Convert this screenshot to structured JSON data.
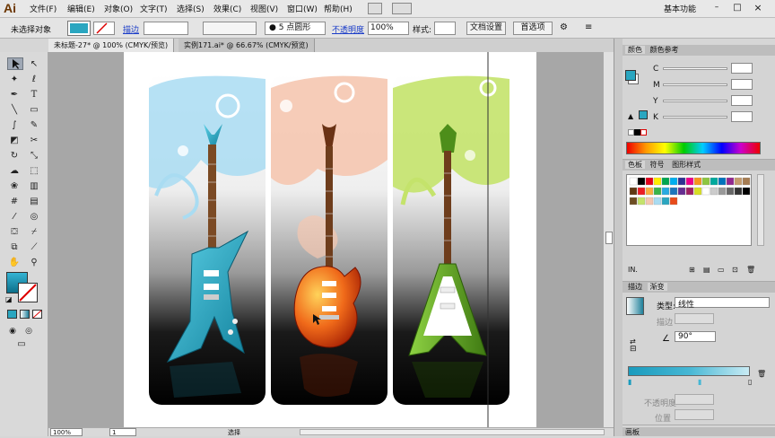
{
  "app": {
    "logo": "Ai",
    "workspace": "基本功能"
  },
  "menu": [
    "文件(F)",
    "编辑(E)",
    "对象(O)",
    "文字(T)",
    "选择(S)",
    "效果(C)",
    "视图(V)",
    "窗口(W)",
    "帮助(H)"
  ],
  "options": {
    "selection_label": "未选择对象",
    "stroke_label": "描边",
    "brush_value": "5 点圆形",
    "opacity_label": "不透明度",
    "opacity_value": "100%",
    "style_label": "样式:",
    "doc_setup": "文档设置",
    "prefs": "首选项"
  },
  "tabs": [
    {
      "label": "未标题-27* @ 100% (CMYK/预览)"
    },
    {
      "label": "实例171.ai* @ 66.67% (CMYK/预览)"
    }
  ],
  "color_panel": {
    "tabs": [
      "颜色",
      "颜色参考"
    ],
    "channels": [
      {
        "label": "C"
      },
      {
        "label": "M"
      },
      {
        "label": "Y"
      },
      {
        "label": "K"
      }
    ]
  },
  "swatches_panel": {
    "tabs": [
      "色板",
      "符号",
      "图形样式"
    ]
  },
  "gradient_panel": {
    "tabs": [
      "描边",
      "渐变"
    ],
    "type_label": "类型:",
    "type_value": "线性",
    "stroke_label": "描边",
    "angle_value": "90°",
    "opacity_label": "不透明度",
    "location_label": "位置"
  },
  "bottom_panel": {
    "label": "画板"
  },
  "status": {
    "zoom": "100%",
    "page": "1",
    "tool": "选择"
  },
  "colors": {
    "teal": "#2aa6c0",
    "orange": "#e84b1a",
    "green": "#6aa624",
    "panel_peach": "#f5c7b0",
    "panel_blue": "#a9dcf2",
    "panel_lime": "#c4e36b"
  },
  "icons": [
    "selection-icon",
    "direct-selection-icon",
    "magic-wand-icon",
    "lasso-icon",
    "pen-icon",
    "type-icon",
    "line-icon",
    "rect-icon",
    "brush-icon",
    "pencil-icon",
    "eraser-icon",
    "scissors-icon",
    "rotate-icon",
    "scale-icon",
    "warp-icon",
    "free-transform-icon",
    "symbol-icon",
    "graph-icon",
    "mesh-icon",
    "gradient-icon",
    "eyedropper-icon",
    "blend-icon",
    "slice-icon",
    "hand-icon",
    "zoom-icon"
  ]
}
